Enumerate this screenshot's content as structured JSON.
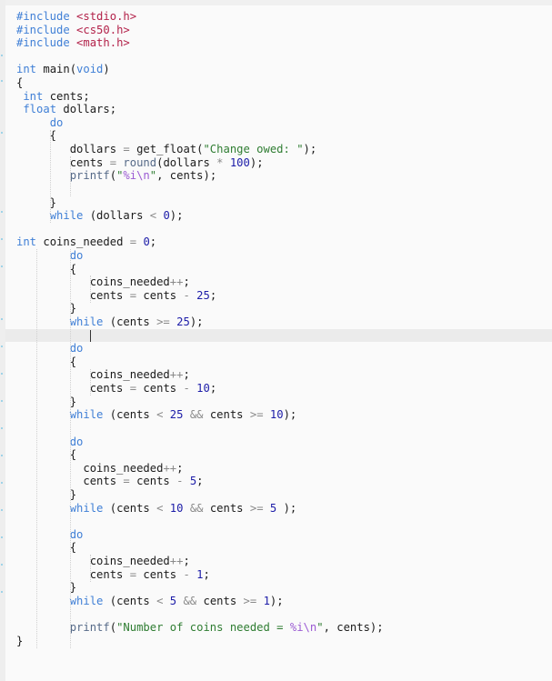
{
  "editor": {
    "language": "C",
    "current_line": 24,
    "lines": [
      [
        {
          "t": "#include",
          "c": "pp"
        },
        {
          "t": " "
        },
        {
          "t": "<stdio.h>",
          "c": "hdr"
        }
      ],
      [
        {
          "t": "#include",
          "c": "pp"
        },
        {
          "t": " "
        },
        {
          "t": "<cs50.h>",
          "c": "hdr"
        }
      ],
      [
        {
          "t": "#include",
          "c": "pp"
        },
        {
          "t": " "
        },
        {
          "t": "<math.h>",
          "c": "hdr"
        }
      ],
      [],
      [
        {
          "t": "int",
          "c": "kw"
        },
        {
          "t": " main("
        },
        {
          "t": "void",
          "c": "kw"
        },
        {
          "t": ")"
        }
      ],
      [
        {
          "t": "{"
        }
      ],
      [
        {
          "t": " "
        },
        {
          "t": "int",
          "c": "kw"
        },
        {
          "t": " cents;"
        }
      ],
      [
        {
          "t": " "
        },
        {
          "t": "float",
          "c": "kw"
        },
        {
          "t": " dollars;"
        }
      ],
      [
        {
          "t": "     "
        },
        {
          "t": "do",
          "c": "kw"
        }
      ],
      [
        {
          "t": "     {"
        }
      ],
      [
        {
          "t": "        dollars "
        },
        {
          "t": "=",
          "c": "op"
        },
        {
          "t": " get_float("
        },
        {
          "t": "\"Change owed: \"",
          "c": "str"
        },
        {
          "t": ");"
        }
      ],
      [
        {
          "t": "        cents "
        },
        {
          "t": "=",
          "c": "op"
        },
        {
          "t": " "
        },
        {
          "t": "round",
          "c": "fn"
        },
        {
          "t": "(dollars "
        },
        {
          "t": "*",
          "c": "op"
        },
        {
          "t": " "
        },
        {
          "t": "100",
          "c": "num"
        },
        {
          "t": ");"
        }
      ],
      [
        {
          "t": "        "
        },
        {
          "t": "printf",
          "c": "fn"
        },
        {
          "t": "("
        },
        {
          "t": "\"",
          "c": "str"
        },
        {
          "t": "%i\\n",
          "c": "fmt"
        },
        {
          "t": "\"",
          "c": "str"
        },
        {
          "t": ", cents);"
        }
      ],
      [],
      [
        {
          "t": "     }"
        }
      ],
      [
        {
          "t": "     "
        },
        {
          "t": "while",
          "c": "kw"
        },
        {
          "t": " (dollars "
        },
        {
          "t": "<",
          "c": "op"
        },
        {
          "t": " "
        },
        {
          "t": "0",
          "c": "num"
        },
        {
          "t": ");"
        }
      ],
      [],
      [
        {
          "t": "int",
          "c": "kw"
        },
        {
          "t": " coins_needed "
        },
        {
          "t": "=",
          "c": "op"
        },
        {
          "t": " "
        },
        {
          "t": "0",
          "c": "num"
        },
        {
          "t": ";"
        }
      ],
      [
        {
          "t": "        "
        },
        {
          "t": "do",
          "c": "kw"
        }
      ],
      [
        {
          "t": "        {"
        }
      ],
      [
        {
          "t": "           coins_needed"
        },
        {
          "t": "++",
          "c": "op"
        },
        {
          "t": ";"
        }
      ],
      [
        {
          "t": "           cents "
        },
        {
          "t": "=",
          "c": "op"
        },
        {
          "t": " cents "
        },
        {
          "t": "-",
          "c": "op"
        },
        {
          "t": " "
        },
        {
          "t": "25",
          "c": "num"
        },
        {
          "t": ";"
        }
      ],
      [
        {
          "t": "        }"
        }
      ],
      [
        {
          "t": "        "
        },
        {
          "t": "while",
          "c": "kw"
        },
        {
          "t": " (cents "
        },
        {
          "t": ">=",
          "c": "op"
        },
        {
          "t": " "
        },
        {
          "t": "25",
          "c": "num"
        },
        {
          "t": ");"
        }
      ],
      [],
      [
        {
          "t": "        "
        },
        {
          "t": "do",
          "c": "kw"
        }
      ],
      [
        {
          "t": "        {"
        }
      ],
      [
        {
          "t": "           coins_needed"
        },
        {
          "t": "++",
          "c": "op"
        },
        {
          "t": ";"
        }
      ],
      [
        {
          "t": "           cents "
        },
        {
          "t": "=",
          "c": "op"
        },
        {
          "t": " cents "
        },
        {
          "t": "-",
          "c": "op"
        },
        {
          "t": " "
        },
        {
          "t": "10",
          "c": "num"
        },
        {
          "t": ";"
        }
      ],
      [
        {
          "t": "        }"
        }
      ],
      [
        {
          "t": "        "
        },
        {
          "t": "while",
          "c": "kw"
        },
        {
          "t": " (cents "
        },
        {
          "t": "<",
          "c": "op"
        },
        {
          "t": " "
        },
        {
          "t": "25",
          "c": "num"
        },
        {
          "t": " "
        },
        {
          "t": "&&",
          "c": "op"
        },
        {
          "t": " cents "
        },
        {
          "t": ">=",
          "c": "op"
        },
        {
          "t": " "
        },
        {
          "t": "10",
          "c": "num"
        },
        {
          "t": ");"
        }
      ],
      [],
      [
        {
          "t": "        "
        },
        {
          "t": "do",
          "c": "kw"
        }
      ],
      [
        {
          "t": "        {"
        }
      ],
      [
        {
          "t": "          coins_needed"
        },
        {
          "t": "++",
          "c": "op"
        },
        {
          "t": ";"
        }
      ],
      [
        {
          "t": "          cents "
        },
        {
          "t": "=",
          "c": "op"
        },
        {
          "t": " cents "
        },
        {
          "t": "-",
          "c": "op"
        },
        {
          "t": " "
        },
        {
          "t": "5",
          "c": "num"
        },
        {
          "t": ";"
        }
      ],
      [
        {
          "t": "        }"
        }
      ],
      [
        {
          "t": "        "
        },
        {
          "t": "while",
          "c": "kw"
        },
        {
          "t": " (cents "
        },
        {
          "t": "<",
          "c": "op"
        },
        {
          "t": " "
        },
        {
          "t": "10",
          "c": "num"
        },
        {
          "t": " "
        },
        {
          "t": "&&",
          "c": "op"
        },
        {
          "t": " cents "
        },
        {
          "t": ">=",
          "c": "op"
        },
        {
          "t": " "
        },
        {
          "t": "5",
          "c": "num"
        },
        {
          "t": " );"
        }
      ],
      [],
      [
        {
          "t": "        "
        },
        {
          "t": "do",
          "c": "kw"
        }
      ],
      [
        {
          "t": "        {"
        }
      ],
      [
        {
          "t": "           coins_needed"
        },
        {
          "t": "++",
          "c": "op"
        },
        {
          "t": ";"
        }
      ],
      [
        {
          "t": "           cents "
        },
        {
          "t": "=",
          "c": "op"
        },
        {
          "t": " cents "
        },
        {
          "t": "-",
          "c": "op"
        },
        {
          "t": " "
        },
        {
          "t": "1",
          "c": "num"
        },
        {
          "t": ";"
        }
      ],
      [
        {
          "t": "        }"
        }
      ],
      [
        {
          "t": "        "
        },
        {
          "t": "while",
          "c": "kw"
        },
        {
          "t": " (cents "
        },
        {
          "t": "<",
          "c": "op"
        },
        {
          "t": " "
        },
        {
          "t": "5",
          "c": "num"
        },
        {
          "t": " "
        },
        {
          "t": "&&",
          "c": "op"
        },
        {
          "t": " cents "
        },
        {
          "t": ">=",
          "c": "op"
        },
        {
          "t": " "
        },
        {
          "t": "1",
          "c": "num"
        },
        {
          "t": ");"
        }
      ],
      [],
      [
        {
          "t": "        "
        },
        {
          "t": "printf",
          "c": "fn"
        },
        {
          "t": "("
        },
        {
          "t": "\"Number of coins needed = ",
          "c": "str"
        },
        {
          "t": "%i\\n",
          "c": "fmt"
        },
        {
          "t": "\"",
          "c": "str"
        },
        {
          "t": ", cents);"
        }
      ],
      [
        {
          "t": "}"
        }
      ]
    ]
  },
  "colors": {
    "keyword": "#3f7fd6",
    "header": "#b3224a",
    "string": "#2f7d32",
    "format_specifier": "#9b5bd3",
    "number": "#1c1ca8",
    "operator": "#8a8a8a",
    "function": "#566a88",
    "background": "#fafafa",
    "current_line": "#ebebeb"
  }
}
